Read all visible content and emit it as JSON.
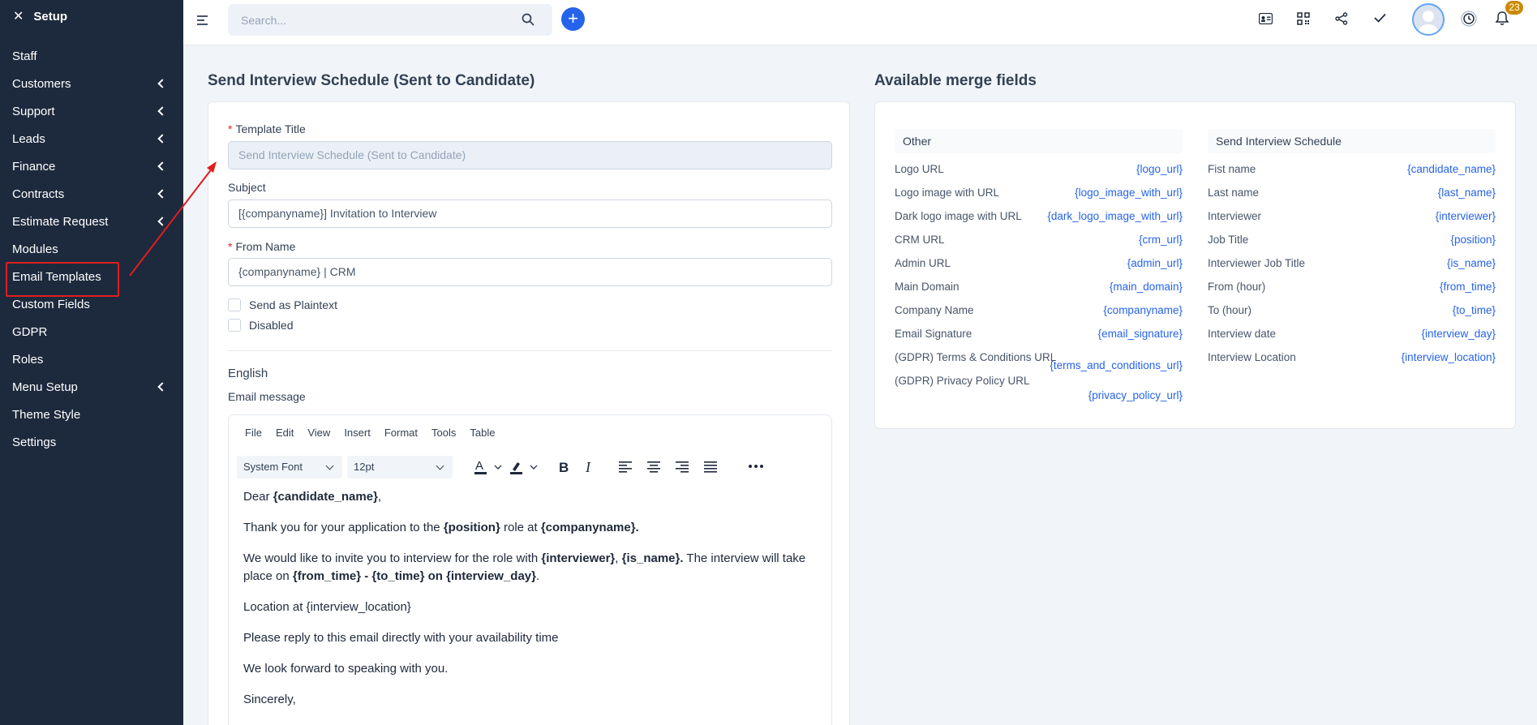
{
  "sidebar": {
    "title": "Setup",
    "items": [
      {
        "label": "Staff",
        "chevron": false
      },
      {
        "label": "Customers",
        "chevron": true
      },
      {
        "label": "Support",
        "chevron": true
      },
      {
        "label": "Leads",
        "chevron": true
      },
      {
        "label": "Finance",
        "chevron": true
      },
      {
        "label": "Contracts",
        "chevron": true
      },
      {
        "label": "Estimate Request",
        "chevron": true
      },
      {
        "label": "Modules",
        "chevron": false
      },
      {
        "label": "Email Templates",
        "chevron": false,
        "highlighted": true
      },
      {
        "label": "Custom Fields",
        "chevron": false
      },
      {
        "label": "GDPR",
        "chevron": false
      },
      {
        "label": "Roles",
        "chevron": false
      },
      {
        "label": "Menu Setup",
        "chevron": true
      },
      {
        "label": "Theme Style",
        "chevron": false
      },
      {
        "label": "Settings",
        "chevron": false
      }
    ]
  },
  "topbar": {
    "search_placeholder": "Search...",
    "notification_count": "23",
    "icons": [
      "contact-card-icon",
      "qr-code-icon",
      "share-icon",
      "check-icon",
      "avatar",
      "clock-icon",
      "bell-icon"
    ]
  },
  "form": {
    "heading": "Send Interview Schedule (Sent to Candidate)",
    "template_title_label": "Template Title",
    "template_title_value": "Send Interview Schedule (Sent to Candidate)",
    "subject_label": "Subject",
    "subject_value": "[{companyname}] Invitation to Interview",
    "from_name_label": "From Name",
    "from_name_value": "{companyname} | CRM",
    "send_plaintext_label": "Send as Plaintext",
    "disabled_label": "Disabled",
    "language": "English",
    "email_message_label": "Email message"
  },
  "editor": {
    "menus": [
      "File",
      "Edit",
      "View",
      "Insert",
      "Format",
      "Tools",
      "Table"
    ],
    "font_family": "System Font",
    "font_size": "12pt",
    "paragraphs": {
      "p1_a": "Dear ",
      "p1_b": "{candidate_name}",
      "p1_c": ",",
      "p2_a": "Thank you for your application to the ",
      "p2_b": "{position}",
      "p2_c": " role at ",
      "p2_d": "{companyname}.",
      "p3_a": "We would like to invite you to interview for the role with ",
      "p3_b": "{interviewer}",
      "p3_c": ", ",
      "p3_d": "{is_name}.",
      "p3_e": " The interview will take place on ",
      "p3_f": "{from_time} - {to_time} on {interview_day}",
      "p3_g": ".",
      "p4": "Location at {interview_location}",
      "p5": "Please reply to this email directly with your availability time",
      "p6": "We look forward to speaking with you.",
      "p7": "Sincerely,"
    }
  },
  "merge": {
    "heading": "Available merge fields",
    "other_title": "Other",
    "other": [
      {
        "k": "Logo URL",
        "v": "{logo_url}"
      },
      {
        "k": "Logo image with URL",
        "v": "{logo_image_with_url}"
      },
      {
        "k": "Dark logo image with URL",
        "v": "{dark_logo_image_with_url}"
      },
      {
        "k": "CRM URL",
        "v": "{crm_url}"
      },
      {
        "k": "Admin URL",
        "v": "{admin_url}"
      },
      {
        "k": "Main Domain",
        "v": "{main_domain}"
      },
      {
        "k": "Company Name",
        "v": "{companyname}"
      },
      {
        "k": "Email Signature",
        "v": "{email_signature}"
      },
      {
        "k": "(GDPR) Terms & Conditions URL",
        "v": "{terms_and_conditions_url}"
      },
      {
        "k": "(GDPR) Privacy Policy URL",
        "v": "{privacy_policy_url}"
      }
    ],
    "schedule_title": "Send Interview Schedule",
    "schedule": [
      {
        "k": "Fist name",
        "v": "{candidate_name}"
      },
      {
        "k": "Last name",
        "v": "{last_name}"
      },
      {
        "k": "Interviewer",
        "v": "{interviewer}"
      },
      {
        "k": "Job Title",
        "v": "{position}"
      },
      {
        "k": "Interviewer Job Title",
        "v": "{is_name}"
      },
      {
        "k": "From (hour)",
        "v": "{from_time}"
      },
      {
        "k": "To (hour)",
        "v": "{to_time}"
      },
      {
        "k": "Interview date",
        "v": "{interview_day}"
      },
      {
        "k": "Interview Location",
        "v": "{interview_location}"
      }
    ]
  },
  "colors": {
    "sidebar_bg": "#1d2a3d",
    "accent": "#2563eb",
    "highlight_box": "#e11d1d",
    "badge": "#ca8a04"
  }
}
